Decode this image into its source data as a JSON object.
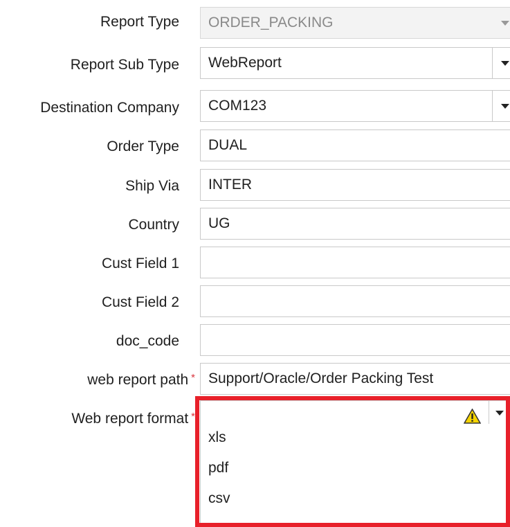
{
  "form": {
    "fields": [
      {
        "label": "Report Type",
        "value": "ORDER_PACKING"
      },
      {
        "label": "Report Sub Type",
        "value": "WebReport"
      },
      {
        "label": "Destination Company",
        "value": "COM123"
      },
      {
        "label": "Order Type",
        "value": "DUAL"
      },
      {
        "label": "Ship Via",
        "value": "INTER"
      },
      {
        "label": "Country",
        "value": "UG"
      },
      {
        "label": "Cust Field 1",
        "value": ""
      },
      {
        "label": "Cust Field 2",
        "value": ""
      },
      {
        "label": "doc_code",
        "value": ""
      },
      {
        "label": "web report path",
        "value": "Support/Oracle/Order Packing Test"
      },
      {
        "label": "Web report format",
        "value": ""
      }
    ],
    "required_marker": "*",
    "format_options": [
      "xls",
      "pdf",
      "csv"
    ]
  },
  "icons": {
    "dropdown": "chevron-down-icon",
    "warning": "warning-icon"
  },
  "colors": {
    "highlight": "#e8202a",
    "required": "#d9363e",
    "disabled_bg": "#f3f3f3",
    "warning_fill": "#f5d400"
  }
}
